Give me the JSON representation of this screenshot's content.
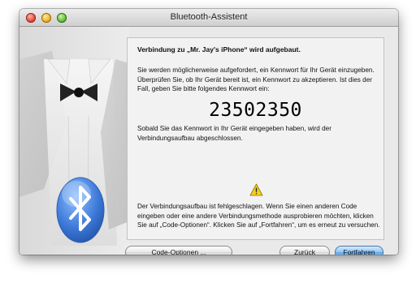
{
  "window": {
    "title": "Bluetooth-Assistent"
  },
  "content": {
    "heading": "Verbindung zu „Mr. Jay's iPhone“ wird aufgebaut.",
    "instructions": "Sie werden möglicherweise aufgefordert, ein Kennwort für Ihr Gerät einzugeben. Überprüfen Sie, ob Ihr Gerät bereit ist, ein Kennwort zu akzeptieren. Ist dies der Fall, geben Sie bitte folgendes Kennwort ein:",
    "passkey": "23502350",
    "after_passkey": "Sobald Sie das Kennwort in Ihr Gerät eingegeben haben, wird der Verbindungsaufbau abgeschlossen.",
    "error_message": "Der Verbindungsaufbau ist fehlgeschlagen. Wenn Sie einen anderen Code eingeben oder eine andere Verbindungsmethode ausprobieren möchten, klicken Sie auf „Code-Optionen“. Klicken Sie auf „Fortfahren“, um es erneut zu versuchen."
  },
  "buttons": {
    "code_options": "Code-Optionen ...",
    "back": "Zurück",
    "continue": "Fortfahren"
  },
  "icons": {
    "warning": "warning-icon",
    "bluetooth": "bluetooth-icon",
    "tuxedo": "tuxedo-illustration"
  },
  "colors": {
    "accent": "#5aa7ea",
    "bluetooth_blue": "#3c78d8"
  }
}
